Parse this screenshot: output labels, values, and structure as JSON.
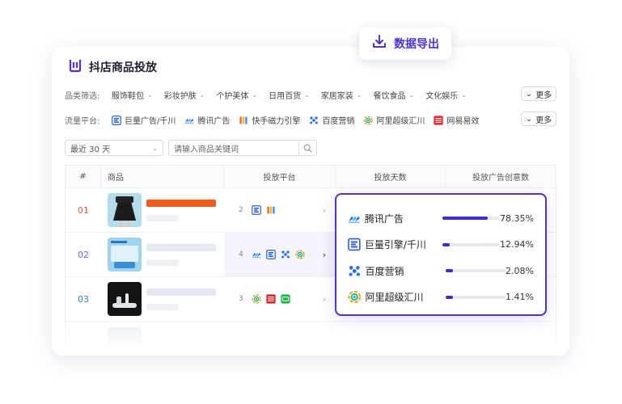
{
  "export_button": {
    "label": "数据导出",
    "icon": "download-icon"
  },
  "header": {
    "title": "抖店商品投放",
    "logo_icon": "douyin-shop-logo-icon"
  },
  "category_filter": {
    "label": "品类筛选:",
    "items": [
      "服饰鞋包",
      "彩妆护肤",
      "个护美体",
      "日用百货",
      "家居家装",
      "餐饮食品",
      "文化娱乐"
    ],
    "more_label": "更多"
  },
  "platform_filter": {
    "label": "流量平台:",
    "items": [
      {
        "label": "巨量广告/千川",
        "icon": "oceanengine-icon"
      },
      {
        "label": "腾讯广告",
        "icon": "tencent-ads-icon"
      },
      {
        "label": "快手磁力引擎",
        "icon": "kuaishou-icon"
      },
      {
        "label": "百度营销",
        "icon": "baidu-icon"
      },
      {
        "label": "阿里超级汇川",
        "icon": "ali-huichuan-icon"
      },
      {
        "label": "网易易效",
        "icon": "netease-icon"
      }
    ],
    "more_label": "更多"
  },
  "date_select": {
    "value": "最近 30 天"
  },
  "search": {
    "placeholder": "请输入商品关键词"
  },
  "table": {
    "headers": [
      "#",
      "商品",
      "投放平台",
      "投放天数",
      "投放广告创意数"
    ],
    "rows": [
      {
        "index": "01",
        "index_color": "#e8553a",
        "platform_count": "2",
        "accent": "#f05a1a"
      },
      {
        "index": "02",
        "index_color": "#7a5cf0",
        "platform_count": "4",
        "accent": "#e5e8f1"
      },
      {
        "index": "03",
        "index_color": "#3a7bf0",
        "platform_count": "3",
        "accent": "#e5e8f1"
      }
    ]
  },
  "popup": {
    "items": [
      {
        "name": "腾讯广告",
        "percent": "78.35%",
        "share": 0.7835,
        "icon": "tencent-ads-icon"
      },
      {
        "name": "巨量引擎/千川",
        "percent": "12.94%",
        "share": 0.1294,
        "icon": "oceanengine-icon"
      },
      {
        "name": "百度营销",
        "percent": "2.08%",
        "share": 0.0208,
        "icon": "baidu-icon"
      },
      {
        "name": "阿里超级汇川",
        "percent": "1.41%",
        "share": 0.0141,
        "icon": "ali-huichuan-icon"
      }
    ]
  },
  "colors": {
    "accent": "#4a33d8",
    "orange": "#f05a1a"
  }
}
